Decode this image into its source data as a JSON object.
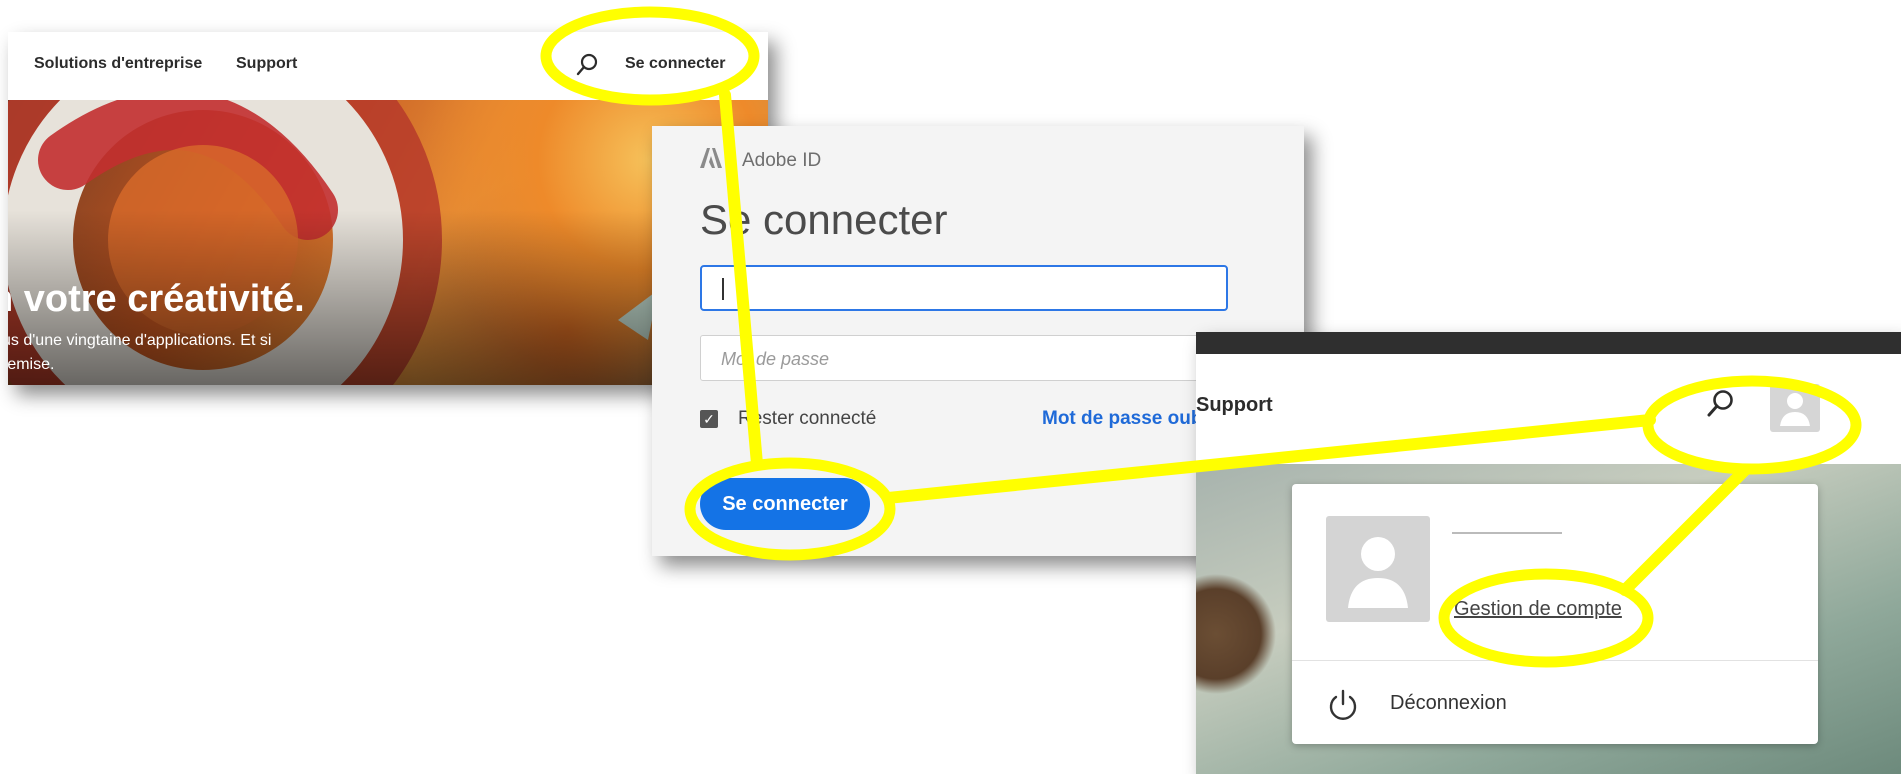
{
  "site": {
    "nav": {
      "solutions": "Solutions d'entreprise",
      "support": "Support",
      "signin": "Se connecter"
    },
    "hero": {
      "headline": "n votre créativité.",
      "subtitle_line1": "us d'une vingtaine d'applications. Et si",
      "subtitle_line2": "remise."
    }
  },
  "login": {
    "brand": "Adobe ID",
    "title": "Se connecter",
    "email_value": "",
    "password_placeholder": "Mot de passe",
    "remember_label": "Rester connecté",
    "remember_checked": true,
    "forgot_link": "Mot de passe oub",
    "signin_button": "Se connecter"
  },
  "account": {
    "nav_support": "Support",
    "menu": {
      "account_management": "Gestion de compte",
      "logout": "Déconnexion"
    }
  },
  "colors": {
    "highlight": "#ffff00",
    "primary_button": "#1473e6",
    "link": "#1f6ad8"
  },
  "icons": [
    "search-icon",
    "adobe-logo-icon",
    "user-avatar-icon",
    "power-icon",
    "checkbox-check-icon"
  ]
}
